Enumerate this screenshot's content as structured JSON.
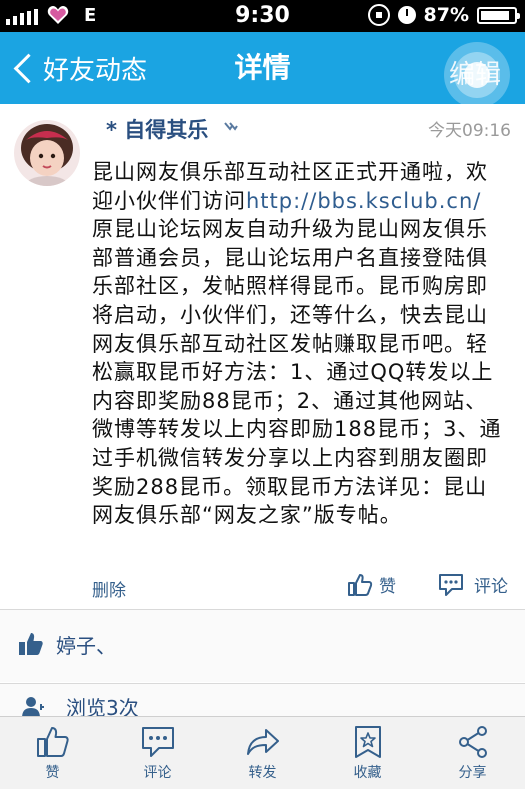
{
  "status_bar": {
    "carrier": "E",
    "time": "9:30",
    "battery": "87%",
    "battery_level": 0.87
  },
  "nav": {
    "back_label": "好友动态",
    "title": "详情",
    "edit_label": "编辑"
  },
  "post": {
    "author": "* 自得其乐",
    "time": "今天09:16",
    "body_part1": "昆山网友俱乐部互动社区正式开通啦，欢迎小伙伴们访问",
    "link": "http://bbs.ksclub.cn/",
    "body_part2": "原昆山论坛网友自动升级为昆山网友俱乐部普通会员，昆山论坛用户名直接登陆俱乐部社区，发帖照样得昆币。昆币购房即将启动，小伙伴们，还等什么，快去昆山网友俱乐部互动社区发帖赚取昆币吧。轻松赢取昆币好方法：1、通过QQ转发以上内容即奖励88昆币；2、通过其他网站、微博等转发以上内容即励188昆币；3、通过手机微信转发分享以上内容到朋友圈即奖励288昆币。领取昆币方法详见：昆山网友俱乐部“网友之家”版专帖。",
    "delete_label": "删除",
    "like_label": "赞",
    "comment_label": "评论"
  },
  "likes": {
    "names": "婷子、"
  },
  "views": {
    "text": "浏览3次"
  },
  "tabbar": {
    "items": [
      {
        "label": "赞",
        "icon": "thumbs-up-icon"
      },
      {
        "label": "评论",
        "icon": "comment-icon"
      },
      {
        "label": "转发",
        "icon": "forward-arrow-icon"
      },
      {
        "label": "收藏",
        "icon": "bookmark-star-icon"
      },
      {
        "label": "分享",
        "icon": "share-icon"
      }
    ]
  },
  "colors": {
    "nav_bg": "#1ba4e2",
    "link": "#2f5d8f",
    "author": "#2a4f80",
    "tab_icon": "#35608c"
  }
}
